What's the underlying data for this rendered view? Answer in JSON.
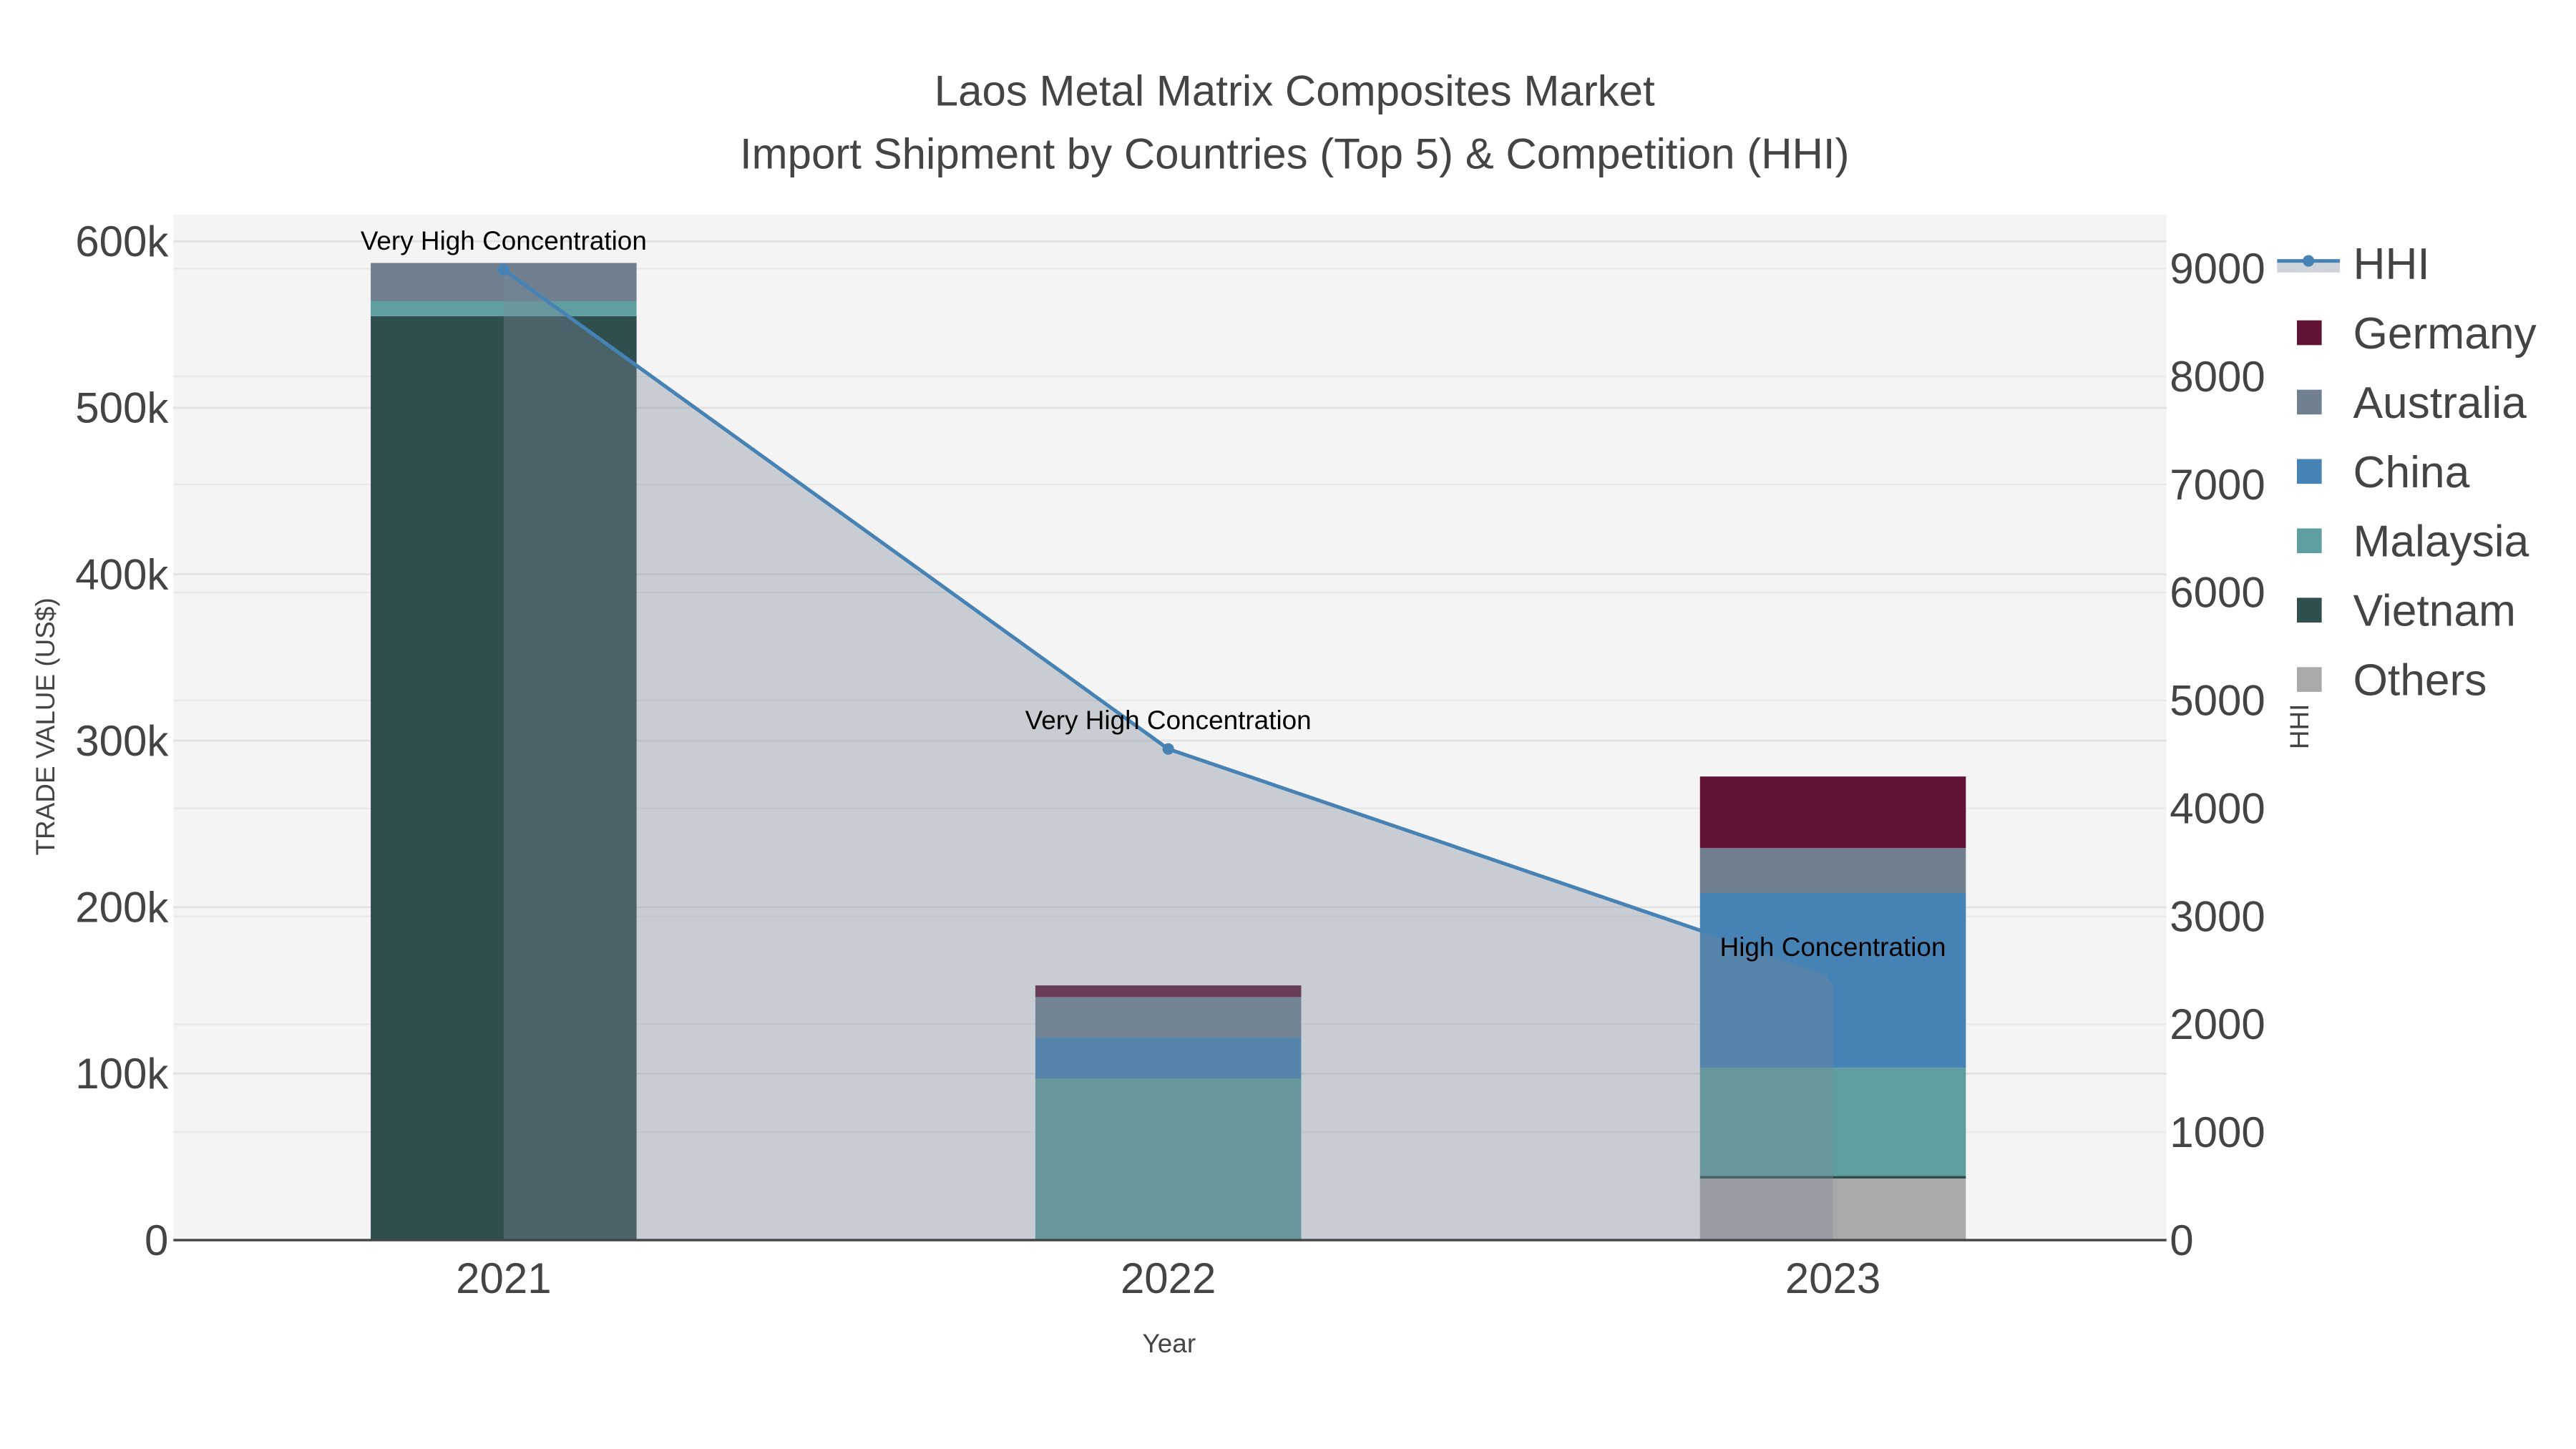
{
  "chart_data": {
    "type": "bar",
    "barmode": "stack",
    "title": "Laos Metal Matrix Composites Market",
    "subtitle": "Import Shipment by Countries (Top 5) & Competition (HHI)",
    "xlabel": "Year",
    "ylabel": "TRADE VALUE (US$)",
    "y2label": "HHI",
    "categories": [
      "2021",
      "2022",
      "2023"
    ],
    "ylim": [
      0,
      616000
    ],
    "y2lim": [
      0,
      9500
    ],
    "yticks": [
      0,
      100000,
      200000,
      300000,
      400000,
      500000,
      600000
    ],
    "ytick_labels": [
      "0",
      "100k",
      "200k",
      "300k",
      "400k",
      "500k",
      "600k"
    ],
    "y2ticks": [
      0,
      1000,
      2000,
      3000,
      4000,
      5000,
      6000,
      7000,
      8000,
      9000
    ],
    "y2tick_labels": [
      "0",
      "1000",
      "2000",
      "3000",
      "4000",
      "5000",
      "6000",
      "7000",
      "8000",
      "9000"
    ],
    "grid": true,
    "legend_placement": "right",
    "series": [
      {
        "name": "Others",
        "color": "#a9a9a9",
        "values": [
          0,
          0,
          37000
        ]
      },
      {
        "name": "Vietnam",
        "color": "#2f4f4f",
        "values": [
          555000,
          0,
          1500
        ]
      },
      {
        "name": "Malaysia",
        "color": "#5f9ea0",
        "values": [
          9000,
          97000,
          65000
        ]
      },
      {
        "name": "China",
        "color": "#4682b4",
        "values": [
          0,
          25000,
          105000
        ]
      },
      {
        "name": "Australia",
        "color": "#708090",
        "values": [
          23000,
          24000,
          27000
        ]
      },
      {
        "name": "Germany",
        "color": "#611335",
        "values": [
          0,
          7000,
          43000
        ]
      }
    ],
    "line": {
      "name": "HHI",
      "color": "#4682b4",
      "fill_color": "#778899",
      "axis": "right",
      "values": [
        8990,
        4550,
        2450
      ]
    },
    "annotations": [
      "Very High Concentration",
      "Very High Concentration",
      "High Concentration"
    ],
    "legend_order": [
      "HHI",
      "Germany",
      "Australia",
      "China",
      "Malaysia",
      "Vietnam",
      "Others"
    ]
  }
}
